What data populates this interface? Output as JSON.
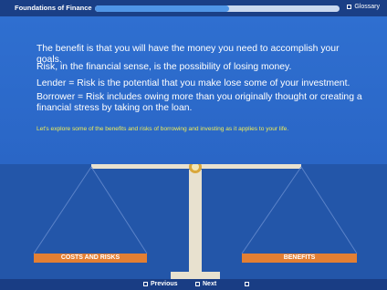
{
  "header": {
    "title": "Foundations of Finance",
    "progress_fraction": 0.55,
    "glossary_label": "Glossary"
  },
  "content": {
    "p1": "The benefit is that you will have the money you need to accomplish your goals.",
    "p2": "Risk, in the financial sense, is the possibility of losing money.",
    "p3": "Lender = Risk is the potential that you make lose some of your investment.",
    "p4": "Borrower = Risk includes owing more than you originally thought or creating a financial stress by taking on the loan.",
    "explore": "Let's explore some of the benefits and risks of borrowing and investing as it applies to your life."
  },
  "scale": {
    "left_label": "COSTS AND RISKS",
    "right_label": "BENEFITS"
  },
  "footer": {
    "previous_label": "Previous",
    "next_label": "Next"
  },
  "colors": {
    "accent_orange": "#e37f33",
    "explore_yellow": "#f2ee54",
    "progress_fill": "#4f95e6"
  }
}
